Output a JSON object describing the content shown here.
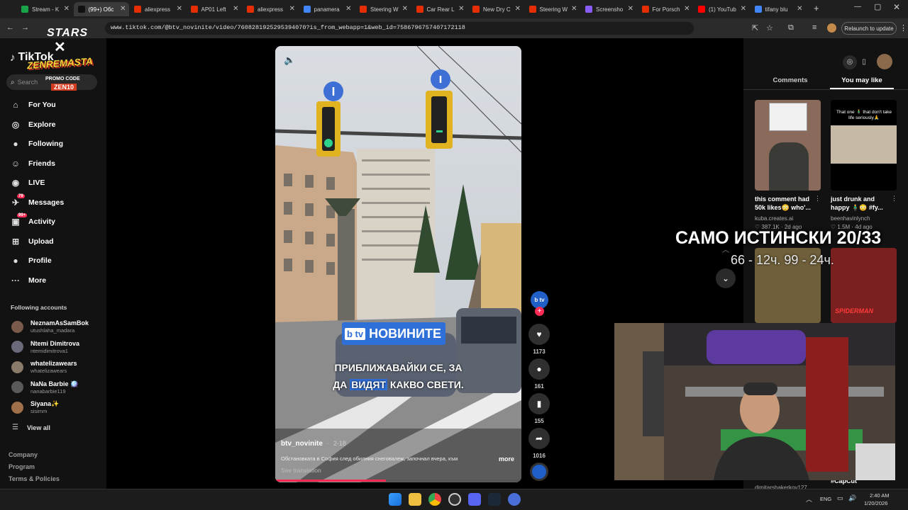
{
  "browser": {
    "tabs": [
      {
        "title": "Stream - K",
        "color": "#1aa34a"
      },
      {
        "title": "(99+) Обс",
        "color": "#111111"
      },
      {
        "title": "aliexpress",
        "color": "#e62e04"
      },
      {
        "title": "AP01 Left",
        "color": "#e62e04"
      },
      {
        "title": "aliexpress",
        "color": "#e62e04"
      },
      {
        "title": "panamera",
        "color": "#4285f4"
      },
      {
        "title": "Steering W",
        "color": "#e62e04"
      },
      {
        "title": "Car Rear L",
        "color": "#e62e04"
      },
      {
        "title": "New Dry C",
        "color": "#e62e04"
      },
      {
        "title": "Steering W",
        "color": "#e62e04"
      },
      {
        "title": "Screensho",
        "color": "#8a5cf6"
      },
      {
        "title": "For Porsch",
        "color": "#e62e04"
      },
      {
        "title": "(1) YouTub",
        "color": "#ff0000"
      },
      {
        "title": "tifany blu",
        "color": "#4285f4"
      }
    ],
    "active_tab_index": 1,
    "address": "www.tiktok.com/@btv_novinite/video/7608281925295394070?is_from_webapp=1&web_id=7586796757407172118",
    "relaunch_label": "Relaunch to update"
  },
  "overlay_brand": {
    "stars_text": "STARS",
    "brand_text": "ZENREMASTA",
    "promo_label": "PROMO CODE",
    "promo_code": "ZEN10"
  },
  "sidebar": {
    "logo_text": "TikTok",
    "search_placeholder": "Search",
    "nav": [
      {
        "label": "For You",
        "icon": "home-icon",
        "glyph": "⌂"
      },
      {
        "label": "Explore",
        "icon": "compass-icon",
        "glyph": "◎"
      },
      {
        "label": "Following",
        "icon": "following-avatar-icon",
        "glyph": "●"
      },
      {
        "label": "Friends",
        "icon": "friends-icon",
        "glyph": "☺"
      },
      {
        "label": "LIVE",
        "icon": "live-icon",
        "glyph": "◉"
      },
      {
        "label": "Messages",
        "icon": "messages-icon",
        "glyph": "✈",
        "badge": "79"
      },
      {
        "label": "Activity",
        "icon": "activity-icon",
        "glyph": "▣",
        "badge": "99+"
      },
      {
        "label": "Upload",
        "icon": "upload-icon",
        "glyph": "⊞"
      },
      {
        "label": "Profile",
        "icon": "profile-avatar-icon",
        "glyph": "●"
      },
      {
        "label": "More",
        "icon": "more-dots-icon",
        "glyph": "···"
      }
    ],
    "following_heading": "Following accounts",
    "accounts": [
      {
        "name": "NeznamAsSamBok",
        "handle": "utushlaha_madara"
      },
      {
        "name": "Ntemi Dimitrova",
        "handle": "ntemidimitrova1"
      },
      {
        "name": "whatelizawears",
        "handle": "whatelizawears"
      },
      {
        "name": "NaNa Barbie 🪩",
        "handle": "nanabarbie119"
      },
      {
        "name": "Siyana✨",
        "handle": "sisimm"
      }
    ],
    "view_all_label": "View all",
    "footer_links": [
      "Company",
      "Program",
      "Terms & Policies"
    ]
  },
  "video": {
    "banner_logo": "b tv",
    "banner_text": "НОВИНИТЕ",
    "caption_line1": "ПРИБЛИЖАВАЙКИ СЕ, ЗА",
    "caption_line2_a": "ДА ",
    "caption_line2_highlight": "ВИДЯТ",
    "caption_line2_b": " КАКВО СВЕТИ.",
    "author": "btv_novinite",
    "date": "2-18",
    "description": "Обстановката в София след обилния снеговалеж, започнал вчера, към",
    "more_label": "more",
    "see_translation": "See translation",
    "progress": 0.45
  },
  "actions": {
    "avatar_logo": "b tv",
    "likes": "1173",
    "comments": "161",
    "saves": "155",
    "shares": "1016"
  },
  "right_panel": {
    "tabs": [
      "Comments",
      "You may like"
    ],
    "active_tab": "You may like",
    "items": [
      {
        "caption": "this comment had 50k likes😳 who'...",
        "author": "kuba.creates.ai",
        "stats": "♡ 387.1K · 2d ago"
      },
      {
        "caption": "just drunk and happy 🧍‍♂️😳 #fy...",
        "author": "beenhavinlynch",
        "stats": "♡ 1.5M · 4d ago"
      },
      {
        "caption": "",
        "author": "dimitarshakerkov127",
        "stats": ""
      },
      {
        "caption": "#CapCut",
        "author": "",
        "stats": ""
      }
    ],
    "thumb2_text": "That one 🧍‍♂️ that don't take life seriously🙏",
    "thumb4_text": "SPIDERMAN"
  },
  "stream_overlay": {
    "title": "САМО ИСТИНСКИ 20/33",
    "subtitle": "66 - 12ч.  99 - 24ч."
  },
  "taskbar": {
    "lang": "ENG",
    "time": "2:40 AM",
    "date": "1/20/2026"
  }
}
